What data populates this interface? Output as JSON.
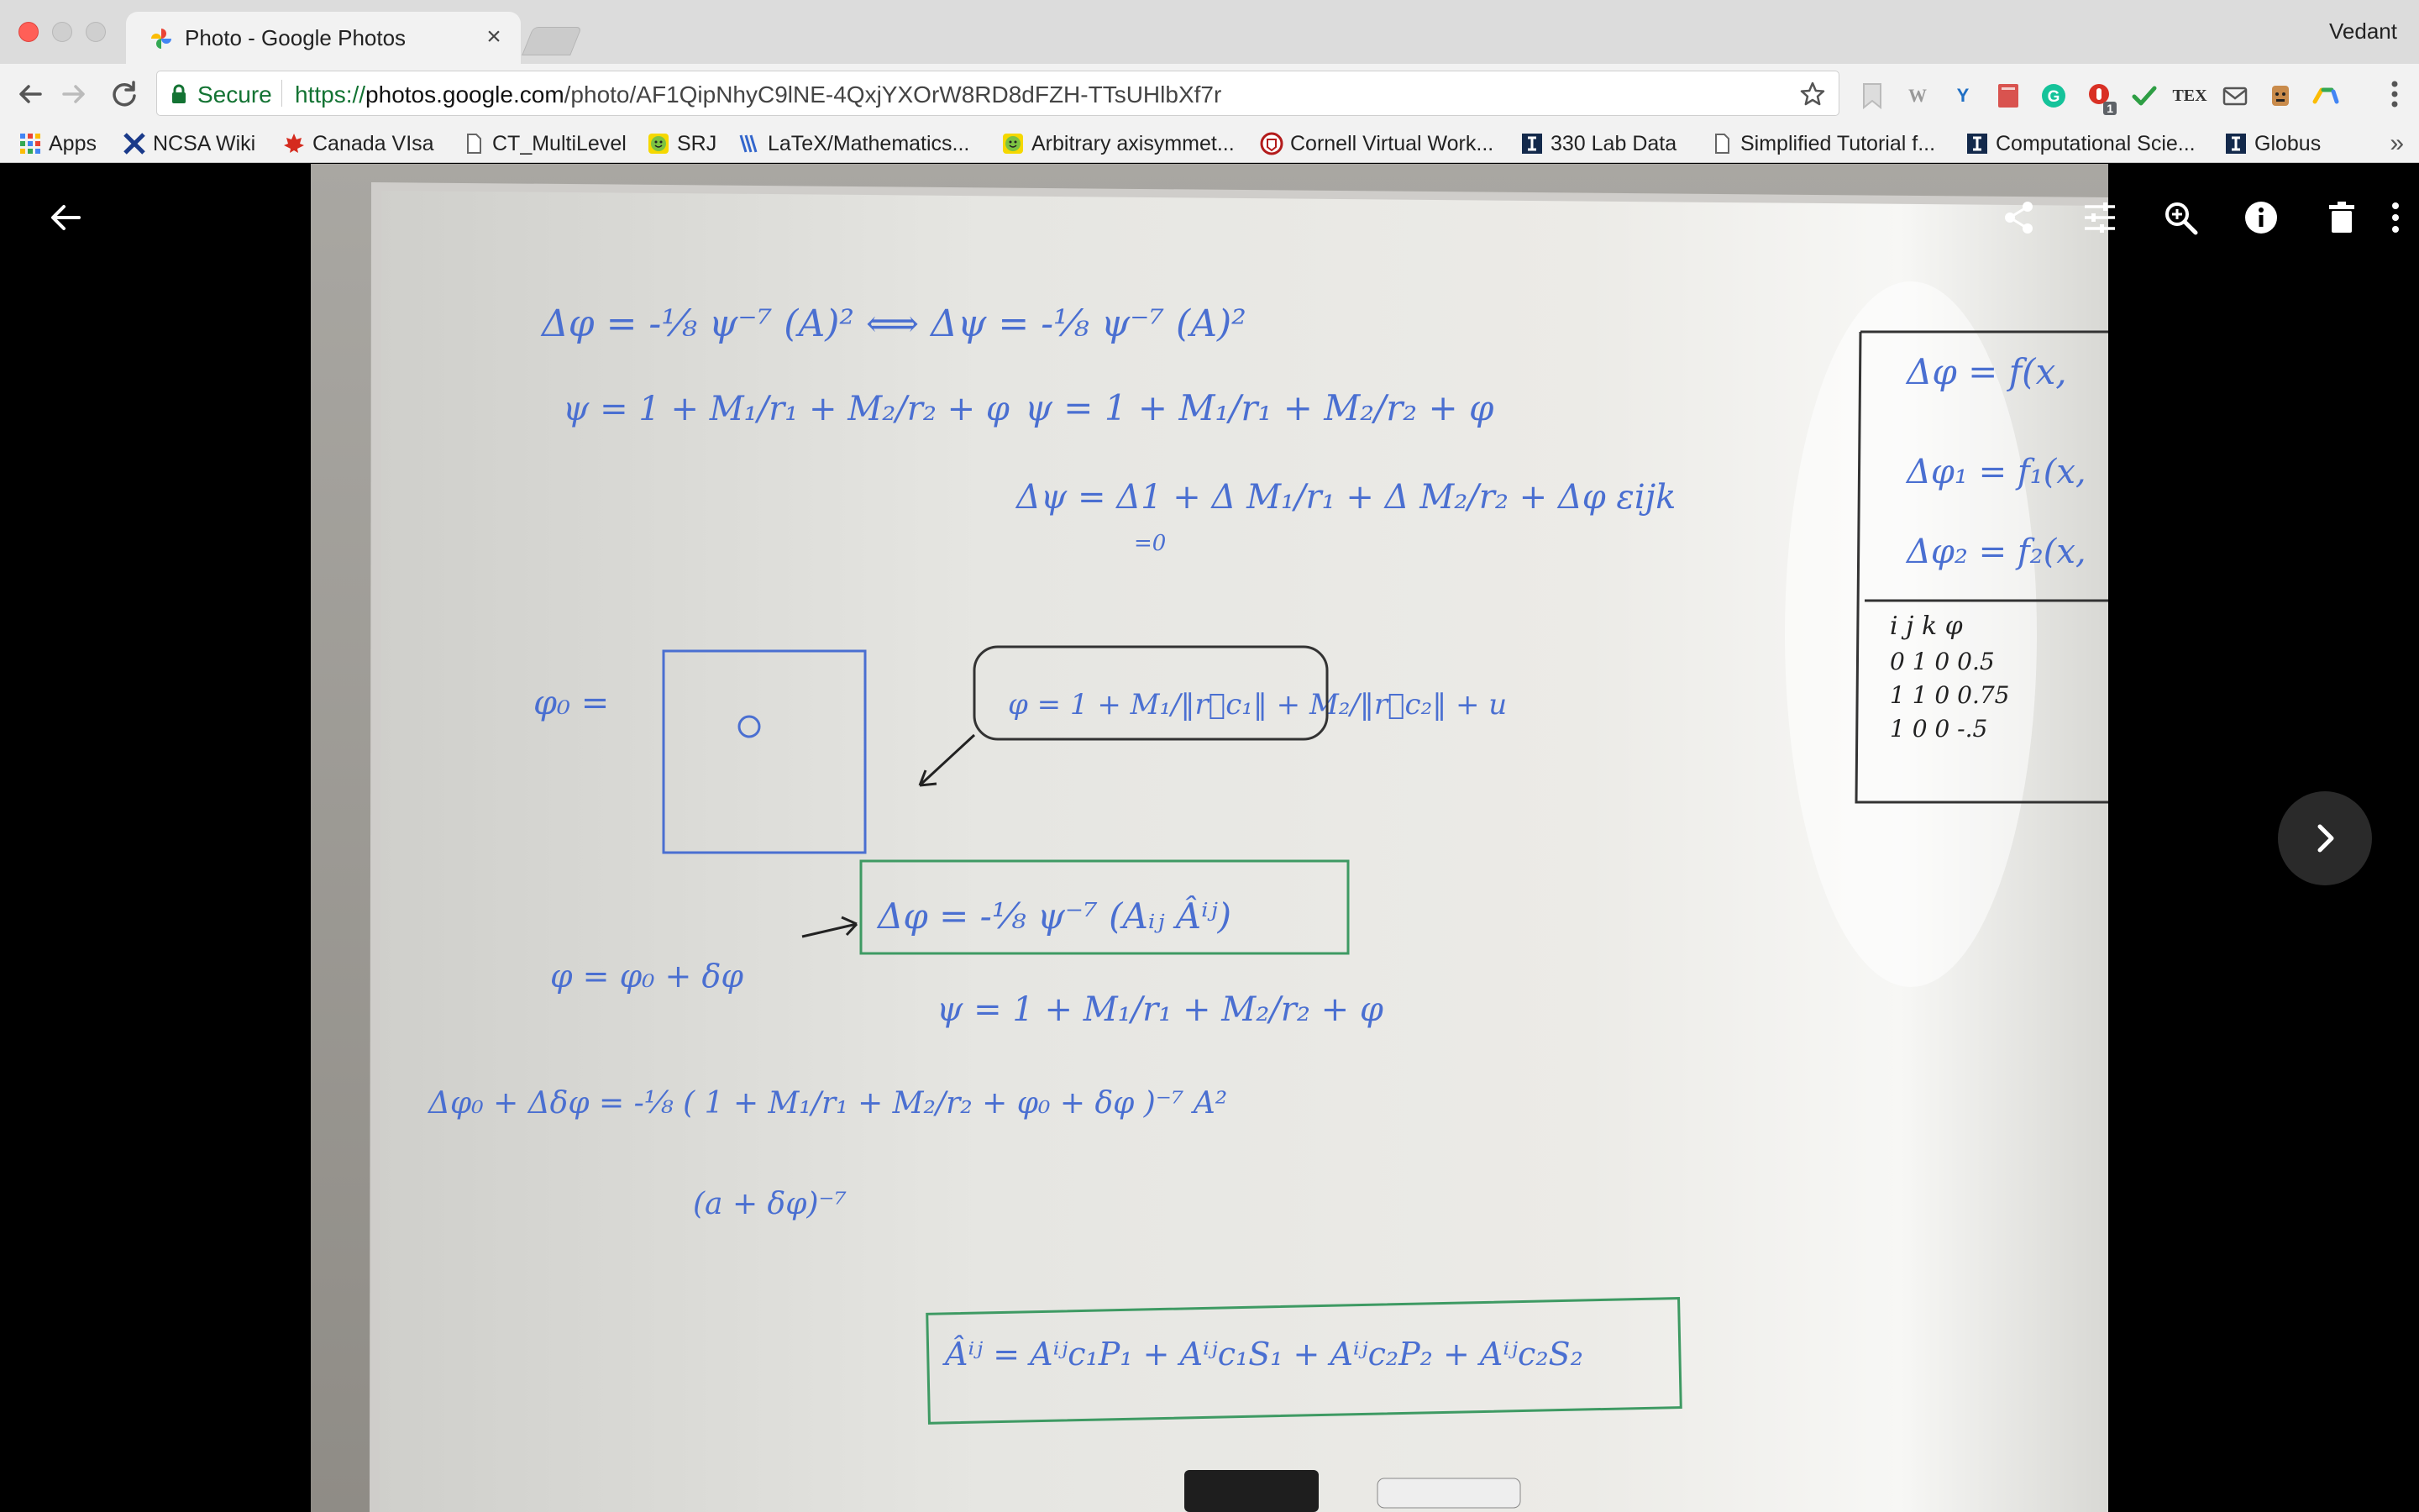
{
  "browser": {
    "tab": {
      "title": "Photo - Google Photos",
      "close_glyph": "×",
      "favicon": "google-photos-pinwheel-icon"
    },
    "profile_name": "Vedant",
    "address": {
      "secure_label": "Secure",
      "url_scheme": "https://",
      "url_host": "photos.google.com",
      "url_path": "/photo/AF1QipNhyC9lNE-4QxjYXOrW8RD8dFZH-TTsUHlbXf7r"
    },
    "extensions": [
      "bookmark-icon",
      "wikipedia-icon",
      "yammer-icon",
      "notes-icon",
      "grammarly-icon",
      "pdf-badge-icon",
      "check-icon",
      "tex-icon",
      "mail-icon",
      "avatar-extension-icon",
      "drive-icon"
    ],
    "extension_badge": "1",
    "extension_tex_label": "TEX",
    "bookmarks": [
      {
        "label": "Apps",
        "icon": "apps-grid-icon"
      },
      {
        "label": "NCSA Wiki",
        "icon": "ncsa-icon"
      },
      {
        "label": "Canada VIsa",
        "icon": "maple-leaf-icon"
      },
      {
        "label": "CT_MultiLevel",
        "icon": "page-icon"
      },
      {
        "label": "SRJ",
        "icon": "smiley-icon"
      },
      {
        "label": "LaTeX/Mathematics...",
        "icon": "wikibooks-icon"
      },
      {
        "label": "Arbitrary axisymmet...",
        "icon": "smiley-icon"
      },
      {
        "label": "Cornell Virtual Work...",
        "icon": "cornell-icon"
      },
      {
        "label": "330 Lab Data",
        "icon": "illinois-icon"
      },
      {
        "label": "Simplified Tutorial f...",
        "icon": "page-icon"
      },
      {
        "label": "Computational Scie...",
        "icon": "illinois-icon"
      },
      {
        "label": "Globus",
        "icon": "illinois-icon"
      }
    ],
    "bookmarks_overflow": "»"
  },
  "viewer": {
    "actions": [
      "share-icon",
      "edit-adjust-icon",
      "zoom-in-icon",
      "info-icon",
      "delete-icon",
      "more-vert-icon"
    ],
    "next": "chevron-right-icon",
    "back": "arrow-back-icon"
  },
  "whiteboard": {
    "colors": {
      "blue": "#4a6fd1",
      "green": "#3e9a63",
      "black": "#222222"
    },
    "lines": [
      "Δφ = -⅛ ψ⁻⁷ (A)²   ⟺   Δψ = -⅛ ψ⁻⁷ (A)²",
      "ψ = 1 + M₁/r₁ + M₂/r₂ + φ",
      "ψ = 1 + M₁/r₁ + M₂/r₂ + φ",
      "Δψ = Δ1 + Δ M₁/r₁ + Δ M₂/r₂ + Δφ    εijk",
      "=0",
      "φ₀ =",
      "φ = 1 + M₁/‖r⃗c₁‖ + M₂/‖r⃗c₂‖ + u",
      "Δφ = -⅛ ψ⁻⁷ (Aᵢⱼ Âⁱʲ)",
      "φ = φ₀ + δφ",
      "ψ = 1 + M₁/r₁ + M₂/r₂ + φ",
      "Δφ₀ + Δδφ = -⅛ ( 1 + M₁/r₁ + M₂/r₂ + φ₀ + δφ )⁻⁷ A²",
      "(a + δφ)⁻⁷",
      "Âⁱʲ = Aⁱʲc₁P₁ + Aⁱʲc₁S₁ + Aⁱʲc₂P₂ + Aⁱʲc₂S₂",
      "Δφ = f(x,",
      "Δφ₁ = f₁(x,",
      "Δφ₂ = f₂(x,",
      "i j k φ",
      "0 1 0 0.5",
      "1 1 0 0.75",
      "1 0 0 -.5"
    ]
  }
}
